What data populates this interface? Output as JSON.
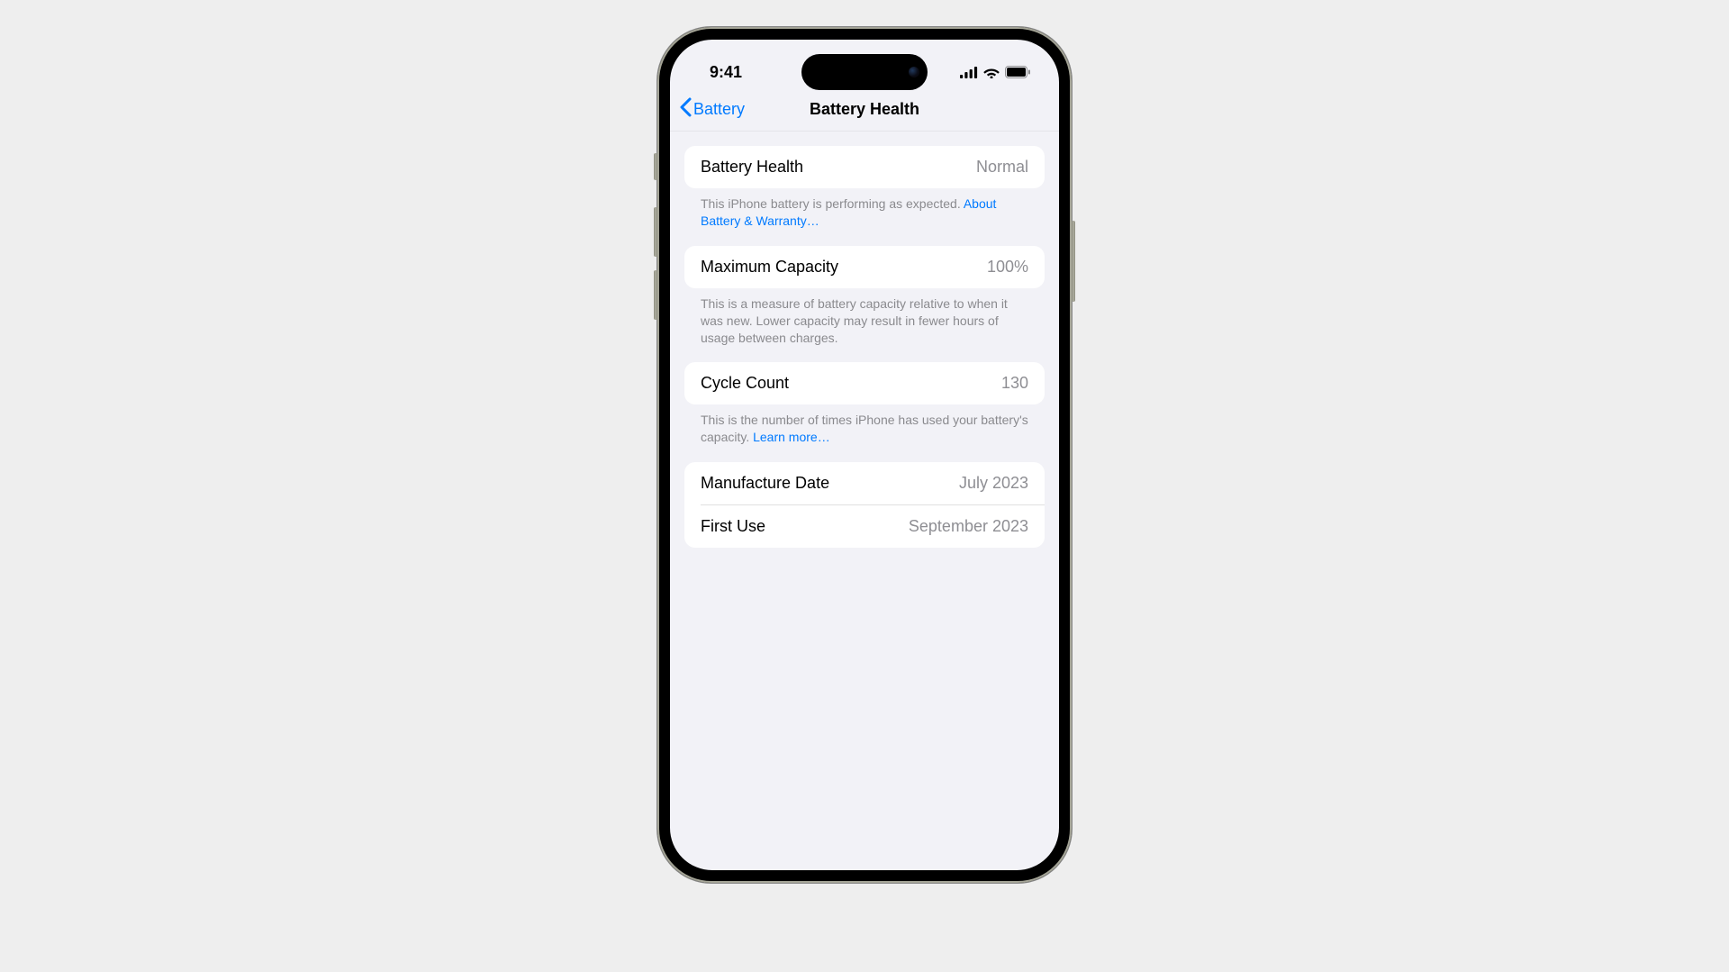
{
  "colors": {
    "accent": "#007aff",
    "background": "#f2f2f7",
    "card": "#ffffff",
    "secondaryText": "#8e8e93"
  },
  "statusBar": {
    "time": "9:41"
  },
  "nav": {
    "backLabel": "Battery",
    "title": "Battery Health"
  },
  "sections": {
    "health": {
      "label": "Battery Health",
      "value": "Normal",
      "footer": "This iPhone battery is performing as expected. ",
      "link": "About Battery & Warranty…"
    },
    "capacity": {
      "label": "Maximum Capacity",
      "value": "100%",
      "footer": "This is a measure of battery capacity relative to when it was new. Lower capacity may result in fewer hours of usage between charges."
    },
    "cycle": {
      "label": "Cycle Count",
      "value": "130",
      "footer": "This is the number of times iPhone has used your battery's capacity. ",
      "link": "Learn more…"
    },
    "dates": {
      "manufacture": {
        "label": "Manufacture Date",
        "value": "July 2023"
      },
      "firstUse": {
        "label": "First Use",
        "value": "September 2023"
      }
    }
  }
}
